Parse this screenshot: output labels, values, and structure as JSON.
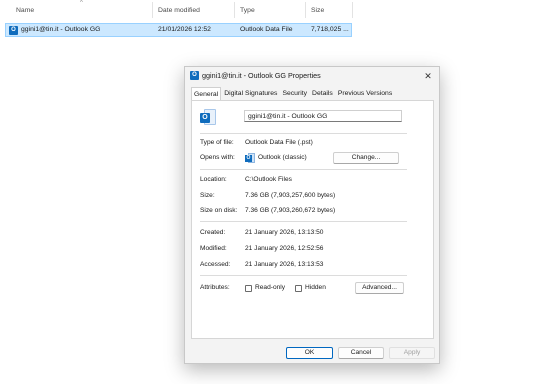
{
  "explorer": {
    "columns": [
      "Name",
      "Date modified",
      "Type",
      "Size"
    ],
    "file": {
      "name": "ggini1@tin.it - Outlook GG",
      "date_modified": "21/01/2026 12:52",
      "type": "Outlook Data File",
      "size": "7,718,025 ..."
    }
  },
  "dialog": {
    "title": "ggini1@tin.it - Outlook GG Properties",
    "close_glyph": "✕",
    "tabs": [
      "General",
      "Digital Signatures",
      "Security",
      "Details",
      "Previous Versions"
    ],
    "active_tab": "General",
    "file_name": "ggini1@tin.it - Outlook GG",
    "type_of_file_label": "Type of file:",
    "type_of_file": "Outlook Data File (.pst)",
    "opens_with_label": "Opens with:",
    "opens_with": "Outlook (classic)",
    "change_button": "Change...",
    "location_label": "Location:",
    "location": "C:\\Outlook Files",
    "size_label": "Size:",
    "size": "7.36 GB (7,903,257,600 bytes)",
    "size_on_disk_label": "Size on disk:",
    "size_on_disk": "7.36 GB (7,903,260,672 bytes)",
    "created_label": "Created:",
    "created": "21 January 2026, 13:13:50",
    "modified_label": "Modified:",
    "modified": "21 January 2026, 12:52:56",
    "accessed_label": "Accessed:",
    "accessed": "21 January 2026, 13:13:53",
    "attributes_label": "Attributes:",
    "readonly_label": "Read-only",
    "hidden_label": "Hidden",
    "advanced_button": "Advanced...",
    "ok_button": "OK",
    "cancel_button": "Cancel",
    "apply_button": "Apply"
  },
  "colors": {
    "selection": "#cce8ff",
    "accent": "#0067c0",
    "outlook_blue": "#0f6cbd"
  },
  "icons": {
    "file_icon": "outlook-data-file-icon",
    "close_icon": "close-icon"
  }
}
